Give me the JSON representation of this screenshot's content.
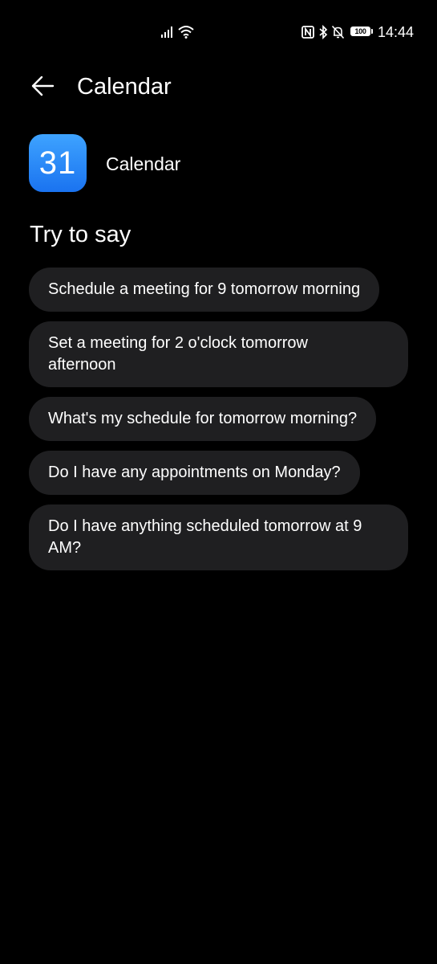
{
  "status_bar": {
    "time": "14:44",
    "battery": "100",
    "icons": [
      "signal-icon",
      "wifi-icon",
      "nfc-icon",
      "bluetooth-icon",
      "bell-off-icon",
      "battery-icon"
    ]
  },
  "header": {
    "title": "Calendar",
    "back_icon": "arrow-left-icon"
  },
  "app": {
    "icon_number": "31",
    "name": "Calendar",
    "icon_color": "#2b8cff"
  },
  "section": {
    "title": "Try to say"
  },
  "suggestions": [
    "Schedule a meeting for 9 tomorrow morning",
    "Set a meeting for 2 o'clock tomorrow afternoon",
    "What's my schedule for tomorrow morning?",
    "Do I have any appointments on Monday?",
    "Do I have anything scheduled tomorrow at 9 AM?"
  ],
  "colors": {
    "background": "#000000",
    "chip_background": "#1f1f21",
    "text": "#ffffff"
  }
}
